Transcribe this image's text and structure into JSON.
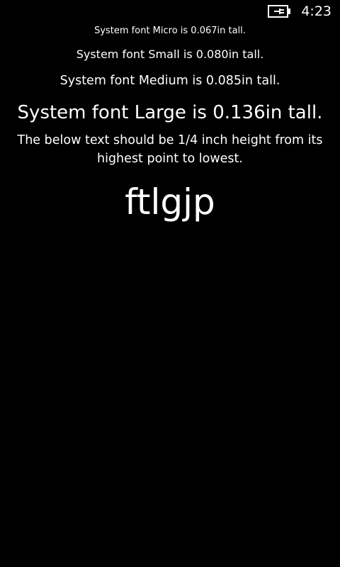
{
  "status_bar": {
    "battery_icon": "battery-charging-icon",
    "time": "4:23"
  },
  "content": {
    "micro_text": "System font Micro is 0.067in tall.",
    "small_text": "System font Small is 0.080in tall.",
    "medium_text": "System font Medium is 0.085in tall.",
    "large_text": "System font Large is 0.136in tall.",
    "instruction_text": "The below text should be 1/4 inch height from its highest point to lowest.",
    "sample_text": "ftlgjp"
  },
  "colors": {
    "background": "#000000",
    "foreground": "#ffffff"
  }
}
